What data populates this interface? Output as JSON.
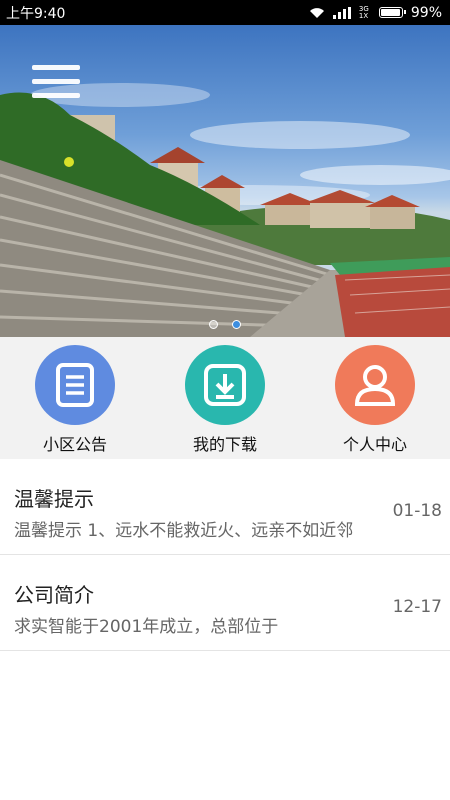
{
  "status_bar": {
    "time": "上午9:40",
    "network": "3G 1X",
    "battery": "99%",
    "battery_level": 0.99
  },
  "colors": {
    "notice": "#5f8be0",
    "download": "#29b7ae",
    "profile": "#f07a5a"
  },
  "shortcuts": [
    {
      "label": "小区公告",
      "icon": "document-icon"
    },
    {
      "label": "我的下载",
      "icon": "download-icon"
    },
    {
      "label": "个人中心",
      "icon": "user-icon"
    }
  ],
  "banner": {
    "page_count": 2,
    "active_page": 2
  },
  "list": [
    {
      "title": "温馨提示",
      "summary": "温馨提示 1、远水不能救近火、远亲不如近邻",
      "date": "01-18"
    },
    {
      "title": "公司简介",
      "summary": "求实智能于2001年成立，总部位于",
      "date": "12-17"
    }
  ]
}
